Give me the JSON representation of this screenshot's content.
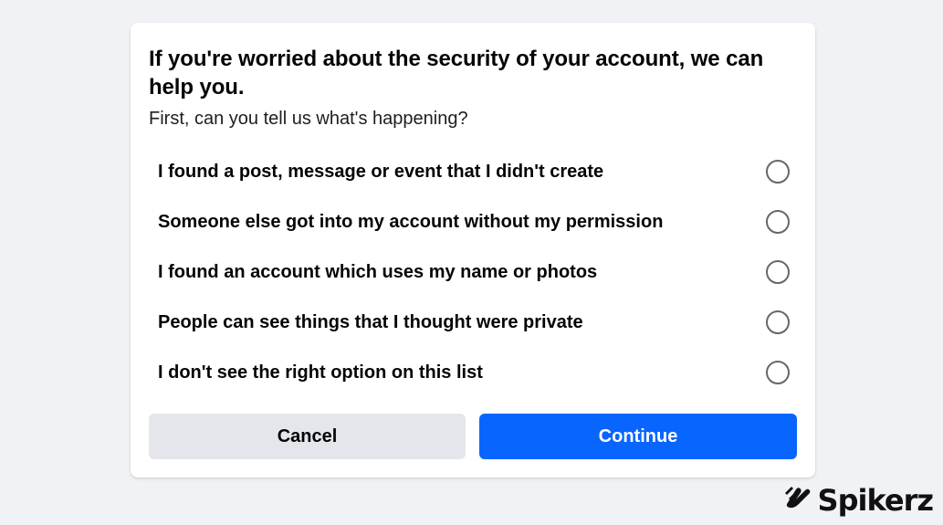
{
  "dialog": {
    "title": "If you're worried about the security of your account, we can help you.",
    "subtitle": "First, can you tell us what's happening?",
    "options": [
      {
        "label": "I found a post, message or event that I didn't create",
        "selected": false
      },
      {
        "label": "Someone else got into my account without my permission",
        "selected": false
      },
      {
        "label": "I found an account which uses my name or photos",
        "selected": false
      },
      {
        "label": "People can see things that I thought were private",
        "selected": false
      },
      {
        "label": "I don't see the right option on this list",
        "selected": false
      }
    ],
    "cancel_label": "Cancel",
    "continue_label": "Continue"
  },
  "watermark": {
    "text": "Spikerz",
    "icon": "hand-wave-logo-icon"
  },
  "colors": {
    "page_background": "#f0f2f5",
    "primary": "#0866ff",
    "secondary_button": "#e4e6eb",
    "radio_border": "#65676b"
  }
}
